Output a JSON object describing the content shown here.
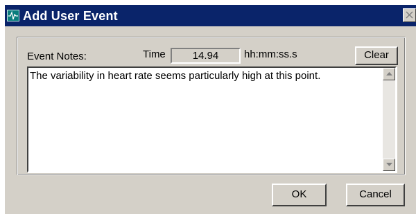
{
  "window": {
    "title": "Add User Event"
  },
  "form": {
    "event_notes_label": "Event Notes:",
    "time_label": "Time",
    "time_value": "14.94",
    "time_format": "hh:mm:ss.s",
    "clear_label": "Clear",
    "notes_text": "The variability in heart rate seems particularly high at this point."
  },
  "footer": {
    "ok_label": "OK",
    "cancel_label": "Cancel"
  },
  "colors": {
    "titlebar": "#0a246a",
    "face": "#d4d0c8",
    "app_icon": "#0a7d7d"
  },
  "icons": {
    "app": "heartbeat-icon",
    "close": "close-icon",
    "scroll_up": "arrow-up-icon",
    "scroll_down": "arrow-down-icon"
  }
}
